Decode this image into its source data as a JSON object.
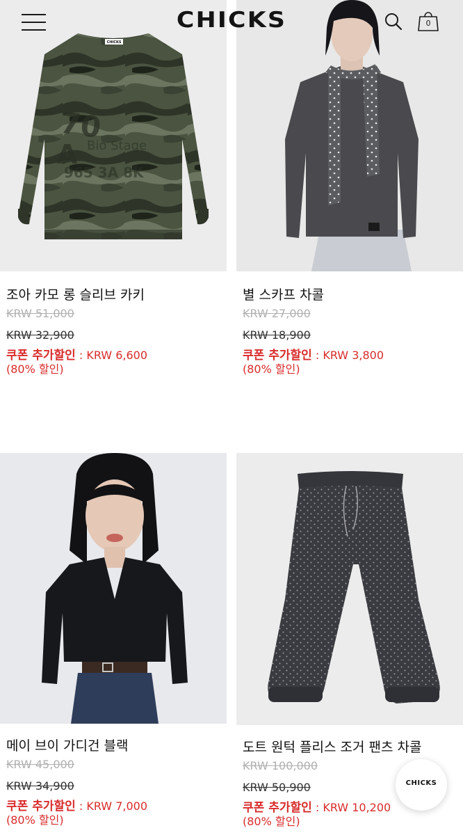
{
  "header": {
    "logo": "CHICKS",
    "cart_count": "0",
    "icons": [
      "hamburger-menu-icon",
      "search-icon",
      "shopping-bag-icon"
    ]
  },
  "products": [
    {
      "name": "조아 카모 롱 슬리브 카키",
      "original_price": "KRW 51,000",
      "sale_price": "KRW 32,900",
      "coupon_label": "쿠폰 추가할인",
      "coupon_price": " : KRW 6,600",
      "discount": "(80% 할인)",
      "image_label": "CHICKS"
    },
    {
      "name": "별 스카프 차콜",
      "original_price": "KRW 27,000",
      "sale_price": "KRW 18,900",
      "coupon_label": "쿠폰 추가할인",
      "coupon_price": " : KRW 3,800",
      "discount": "(80% 할인)"
    },
    {
      "name": "메이 브이 가디건 블랙",
      "original_price": "KRW 45,000",
      "sale_price": "KRW 34,900",
      "coupon_label": "쿠폰 추가할인",
      "coupon_price": " : KRW 7,000",
      "discount": "(80% 할인)"
    },
    {
      "name": "도트 원턱 플리스 조거 팬츠 차콜",
      "original_price": "KRW 100,000",
      "sale_price": "KRW 50,900",
      "coupon_label": "쿠폰 추가할인",
      "coupon_price": " : KRW 10,200",
      "discount": "(80% 할인)"
    }
  ],
  "floating_badge": {
    "label": "CHICKS"
  },
  "colors": {
    "coupon_red": "#d92b2b",
    "strike_gray": "#b0b0b0",
    "photo_bg": "#ececec"
  }
}
